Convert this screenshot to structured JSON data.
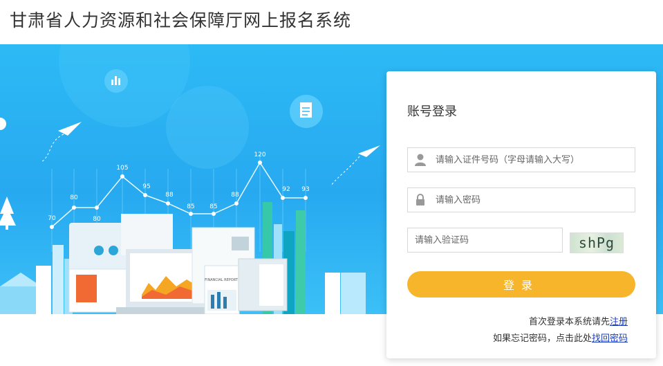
{
  "header": {
    "title": "甘肃省人力资源和社会保障厅网上报名系统"
  },
  "banner": {
    "chart_values": [
      "70",
      "80",
      "80",
      "105",
      "95",
      "88",
      "85",
      "85",
      "88",
      "120",
      "92",
      "93"
    ],
    "report_label": "FINANCIAL REPORT"
  },
  "login": {
    "title": "账号登录",
    "id_placeholder": "请输入证件号码（字母请输入大写）",
    "password_placeholder": "请输入密码",
    "captcha_placeholder": "请输入验证码",
    "captcha_text": "shPg",
    "submit_label": "登录",
    "register_prefix": "首次登录本系统请先",
    "register_link": "注册",
    "forgot_prefix": "如果忘记密码，点击此处",
    "forgot_link": "找回密码"
  },
  "colors": {
    "banner": "#2dbaf5",
    "accent": "#f7b52b",
    "link": "#1a3dba"
  }
}
